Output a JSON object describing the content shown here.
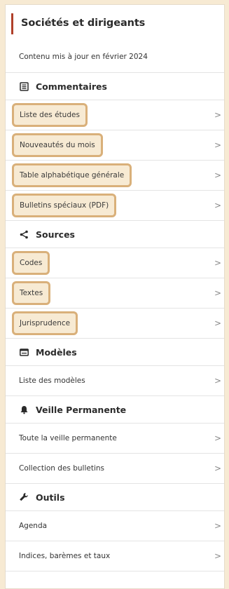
{
  "title": "Sociétés et dirigeants",
  "updated": "Contenu mis à jour en février 2024",
  "sections": {
    "commentaires": {
      "label": "Commentaires",
      "items": [
        "Liste des études",
        "Nouveautés du mois",
        "Table alphabétique générale",
        "Bulletins spéciaux (PDF)"
      ]
    },
    "sources": {
      "label": "Sources",
      "items": [
        "Codes",
        "Textes",
        "Jurisprudence"
      ]
    },
    "modeles": {
      "label": "Modèles",
      "items": [
        "Liste des modèles"
      ]
    },
    "veille": {
      "label": "Veille Permanente",
      "items": [
        "Toute la veille permanente",
        "Collection des bulletins"
      ]
    },
    "outils": {
      "label": "Outils",
      "items": [
        "Agenda",
        "Indices, barèmes et taux"
      ]
    }
  },
  "chevron": ">"
}
